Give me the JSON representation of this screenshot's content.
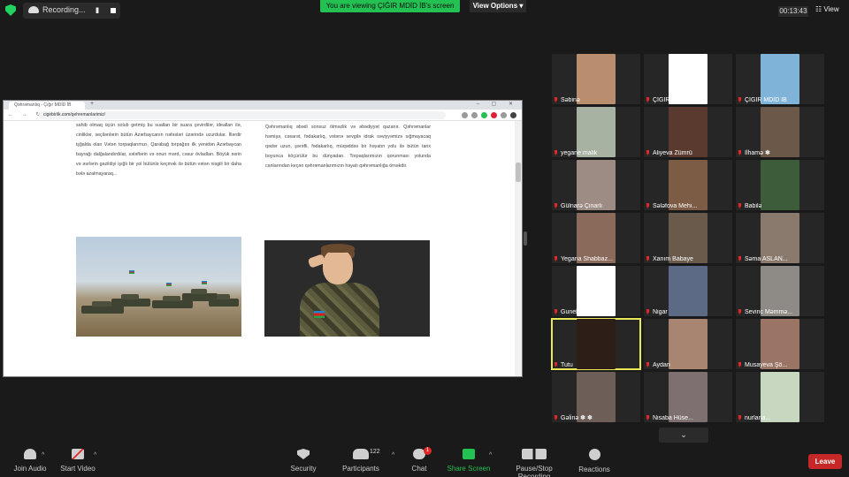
{
  "recording": {
    "label": "Recording...",
    "pause_glyph": "II"
  },
  "banner": {
    "text": "You are viewing ÇIĞIR MDİD İB's screen"
  },
  "view_options": {
    "label": "View Options"
  },
  "meeting": {
    "timer": "00:13:43",
    "view_label": "View"
  },
  "browser": {
    "tab_title": "Qəhrəmanlıq - Çığır MDİD İB",
    "new_tab": "+",
    "url": "cigirbirlik.com/qehremanlarimiz/",
    "nav_glyphs": "← → ↻",
    "window_controls": "– ▢ ✕"
  },
  "article": {
    "left_text": "sahib olmaq üçün solub getmiş bu sualları bir suara çevirdilər, idealları ilə, cinliklər, seçilənlərin bütün Azərbaycanın nəfəsləri üzərində ucurdular. İllərdir işğalda olan Vətən torpaqlarımızı, Qarabağ torpağını ilk yenidən Azərbaycan bayrağı dalğalandırdılar, sələflərin və onun mərd, cəsur övladları. Böyük əsrin və əsrlərin gəzildiyi işığlı bir yol bütünlə keçmək ilə bütün vətən nisgili bir daha bələ azalmayaraq...",
    "right_text": "Qəhrəmanlıq əbədi sonsuz ölməzlik və əbədiyyət qazanır. Qəhrəmanlar həmişə, cəsarət, fədakarlıq, vətənə sevgilə idrak səviyyəmizə sığmayacaq qədər uzun, şərəfli, fədakarlıq, müqəddəs bir həyatın yolu ilə bütün tarix boyunca köçürülür bu dünyadan. Torpaqlarımızın qorunması yolunda canlarından keçən qəhrəmanlarımızın həyatı qəhrəmanlığa örnəkdir."
  },
  "participants_grid": [
    {
      "name": "Səbinə",
      "color": "#b98e6e"
    },
    {
      "name": "ÇIĞIR MDİD İB",
      "color": "#ffffff"
    },
    {
      "name": "ÇIĞIR MDİD İB",
      "color": "#7fb3d8"
    },
    {
      "name": "yegane malik",
      "color": "#a7b2a2"
    },
    {
      "name": "Aliyeva Zümrü",
      "color": "#5a3a2e"
    },
    {
      "name": "İlhamə ✽",
      "color": "#6b5848"
    },
    {
      "name": "Gülnarə Çinarlı",
      "color": "#9c8c84"
    },
    {
      "name": "Sələfova Mehi...",
      "color": "#7d5c46"
    },
    {
      "name": "Babilə",
      "color": "#3d5c3a"
    },
    {
      "name": "Yegana Shabbaz...",
      "color": "#8a6a5a"
    },
    {
      "name": "Xanım Babaye",
      "color": "#6a5a4c"
    },
    {
      "name": "Səma ASLAN...",
      "color": "#8a7a6e"
    },
    {
      "name": "Gunelmuhi",
      "color": "#ffffff"
    },
    {
      "name": "Nigar",
      "color": "#5c6a86"
    },
    {
      "name": "Sevinc Məmmə...",
      "color": "#8e8a86"
    },
    {
      "name": "Tutu",
      "color": "#2e1e18"
    },
    {
      "name": "Aydan",
      "color": "#a88570"
    },
    {
      "name": "Musayeva Şö...",
      "color": "#9a7464"
    },
    {
      "name": "Gəlinə ✽ ✽",
      "color": "#6e5e58"
    },
    {
      "name": "Nisaba Hüse...",
      "color": "#7e7070"
    },
    {
      "name": "nurlana...",
      "color": "#c8d8c0"
    }
  ],
  "scroll_down": {
    "label": "⌄"
  },
  "toolbar": {
    "join_audio": "Join Audio",
    "start_video": "Start Video",
    "security": "Security",
    "participants": "Participants",
    "participants_count": "122",
    "chat": "Chat",
    "chat_badge": "1",
    "share_screen": "Share Screen",
    "pause_recording": "Pause/Stop Recording",
    "reactions": "Reactions",
    "leave": "Leave"
  }
}
